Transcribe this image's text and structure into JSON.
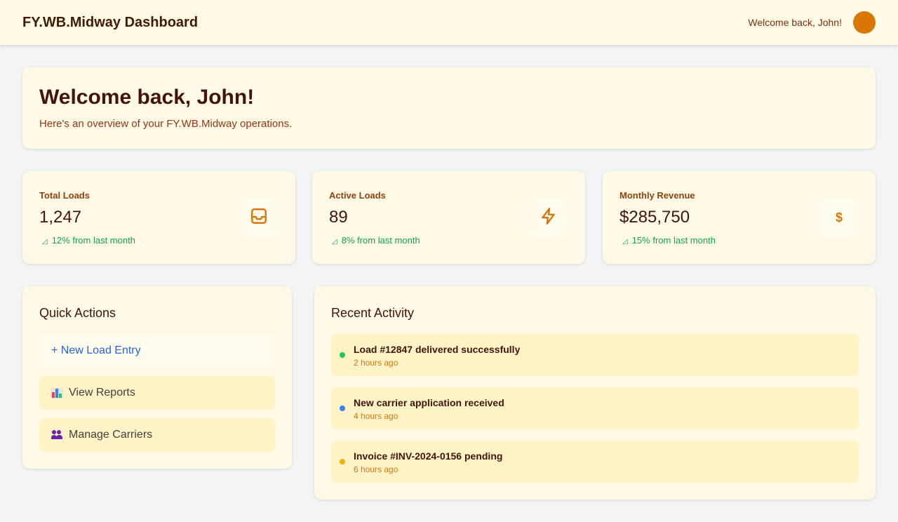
{
  "header": {
    "brand": "FY.WB.Midway Dashboard",
    "welcome": "Welcome back, John!"
  },
  "hero": {
    "title": "Welcome back, John!",
    "subtitle": "Here's an overview of your FY.WB.Midway operations."
  },
  "stats": [
    {
      "label": "Total Loads",
      "value": "1,247",
      "change": "12% from last month",
      "icon": "inbox-icon"
    },
    {
      "label": "Active Loads",
      "value": "89",
      "change": "8% from last month",
      "icon": "lightning-icon"
    },
    {
      "label": "Monthly Revenue",
      "value": "$285,750",
      "change": "15% from last month",
      "icon": "dollar-icon",
      "icon_text": "$"
    }
  ],
  "quick_actions": {
    "title": "Quick Actions",
    "items": [
      {
        "label": "+ New Load Entry"
      },
      {
        "label": "View Reports",
        "icon": "bar-chart-icon"
      },
      {
        "label": "Manage Carriers",
        "icon": "people-icon"
      }
    ]
  },
  "recent_activity": {
    "title": "Recent Activity",
    "items": [
      {
        "title": "Load #12847 delivered successfully",
        "time": "2 hours ago",
        "color": "#22c55e"
      },
      {
        "title": "New carrier application received",
        "time": "4 hours ago",
        "color": "#3b82f6"
      },
      {
        "title": "Invoice #INV-2024-0156 pending",
        "time": "6 hours ago",
        "color": "#eab308"
      }
    ]
  },
  "colors": {
    "accent": "#d97706",
    "positive": "#16a34a",
    "link": "#2563eb"
  }
}
